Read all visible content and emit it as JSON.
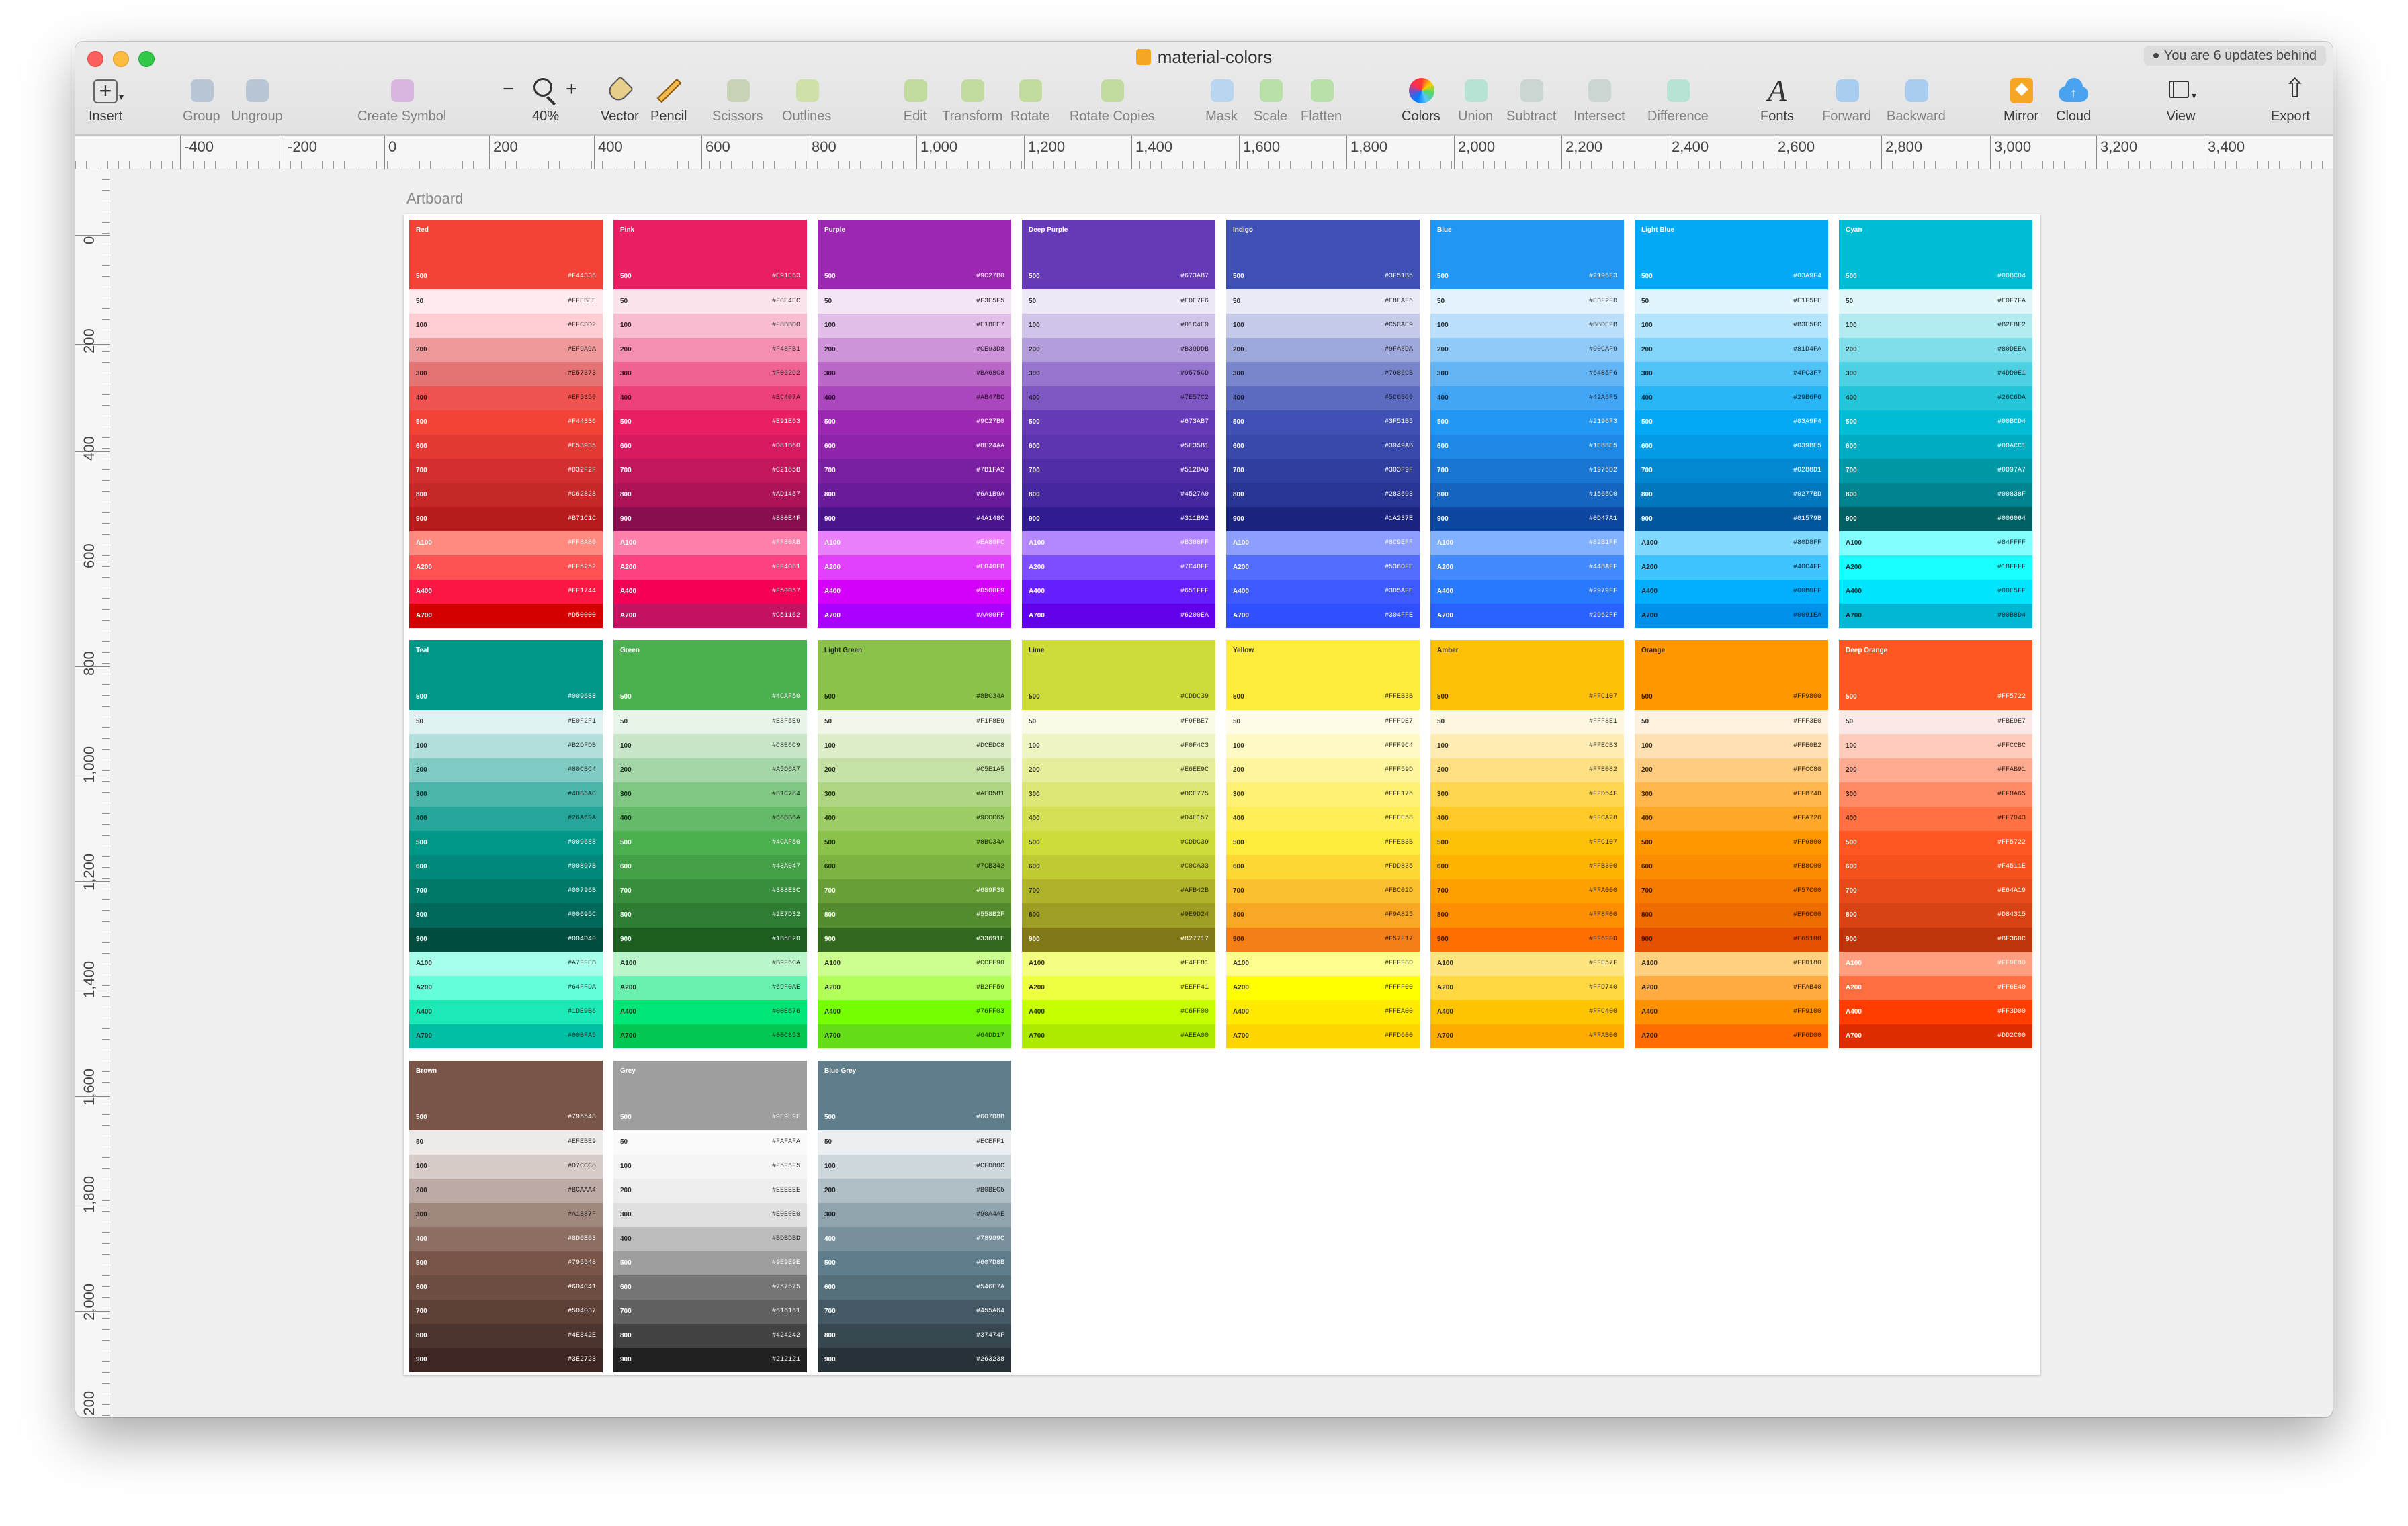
{
  "window": {
    "title": "material-colors",
    "updates_badge": "You are 6 updates behind"
  },
  "toolbar": {
    "items": [
      {
        "label": "Insert",
        "icon": "plus-icon"
      },
      {
        "label": "Group",
        "icon": "group-icon"
      },
      {
        "label": "Ungroup",
        "icon": "ungroup-icon"
      },
      {
        "label": "Create Symbol",
        "icon": "symbol-icon"
      },
      {
        "label": "40%",
        "icon": "zoom-icon"
      },
      {
        "label": "Vector",
        "icon": "vector-pen-icon"
      },
      {
        "label": "Pencil",
        "icon": "pencil-icon"
      },
      {
        "label": "Scissors",
        "icon": "scissors-icon"
      },
      {
        "label": "Outlines",
        "icon": "outlines-icon"
      },
      {
        "label": "Edit",
        "icon": "edit-icon"
      },
      {
        "label": "Transform",
        "icon": "transform-icon"
      },
      {
        "label": "Rotate",
        "icon": "rotate-icon"
      },
      {
        "label": "Rotate Copies",
        "icon": "rotate-copies-icon"
      },
      {
        "label": "Mask",
        "icon": "mask-icon"
      },
      {
        "label": "Scale",
        "icon": "scale-icon"
      },
      {
        "label": "Flatten",
        "icon": "flatten-icon"
      },
      {
        "label": "Colors",
        "icon": "color-wheel-icon"
      },
      {
        "label": "Union",
        "icon": "union-icon"
      },
      {
        "label": "Subtract",
        "icon": "subtract-icon"
      },
      {
        "label": "Intersect",
        "icon": "intersect-icon"
      },
      {
        "label": "Difference",
        "icon": "difference-icon"
      },
      {
        "label": "Fonts",
        "icon": "font-icon"
      },
      {
        "label": "Forward",
        "icon": "forward-icon"
      },
      {
        "label": "Backward",
        "icon": "backward-icon"
      },
      {
        "label": "Mirror",
        "icon": "mirror-icon"
      },
      {
        "label": "Cloud",
        "icon": "cloud-icon"
      },
      {
        "label": "View",
        "icon": "view-icon"
      },
      {
        "label": "Export",
        "icon": "export-icon"
      }
    ],
    "zoom_minus": "−",
    "zoom_plus": "+"
  },
  "ruler": {
    "horizontal": [
      "-400",
      "-200",
      "0",
      "200",
      "400",
      "600",
      "800",
      "1,000",
      "1,200",
      "1,400",
      "1,600",
      "1,800",
      "2,000",
      "2,200",
      "2,400",
      "2,600",
      "2,800",
      "3,000",
      "3,200",
      "3,400"
    ],
    "vertical": [
      "0",
      "200",
      "400",
      "600",
      "800",
      "1,000",
      "1,200",
      "1,400",
      "1,600",
      "1,800",
      "2,000",
      "2,200"
    ]
  },
  "artboard": {
    "label": "Artboard"
  },
  "palettes": [
    {
      "name": "Red",
      "head_hex": "#F44336",
      "text": "light",
      "rows": [
        [
          "50",
          "#FFEBEE"
        ],
        [
          "100",
          "#FFCDD2"
        ],
        [
          "200",
          "#EF9A9A"
        ],
        [
          "300",
          "#E57373"
        ],
        [
          "400",
          "#EF5350"
        ],
        [
          "500",
          "#F44336"
        ],
        [
          "600",
          "#E53935"
        ],
        [
          "700",
          "#D32F2F"
        ],
        [
          "800",
          "#C62828"
        ],
        [
          "900",
          "#B71C1C"
        ],
        [
          "A100",
          "#FF8A80"
        ],
        [
          "A200",
          "#FF5252"
        ],
        [
          "A400",
          "#FF1744"
        ],
        [
          "A700",
          "#D50000"
        ]
      ]
    },
    {
      "name": "Pink",
      "head_hex": "#E91E63",
      "text": "light",
      "rows": [
        [
          "50",
          "#FCE4EC"
        ],
        [
          "100",
          "#F8BBD0"
        ],
        [
          "200",
          "#F48FB1"
        ],
        [
          "300",
          "#F06292"
        ],
        [
          "400",
          "#EC407A"
        ],
        [
          "500",
          "#E91E63"
        ],
        [
          "600",
          "#D81B60"
        ],
        [
          "700",
          "#C2185B"
        ],
        [
          "800",
          "#AD1457"
        ],
        [
          "900",
          "#880E4F"
        ],
        [
          "A100",
          "#FF80AB"
        ],
        [
          "A200",
          "#FF4081"
        ],
        [
          "A400",
          "#F50057"
        ],
        [
          "A700",
          "#C51162"
        ]
      ]
    },
    {
      "name": "Purple",
      "head_hex": "#9C27B0",
      "text": "light",
      "rows": [
        [
          "50",
          "#F3E5F5"
        ],
        [
          "100",
          "#E1BEE7"
        ],
        [
          "200",
          "#CE93D8"
        ],
        [
          "300",
          "#BA68C8"
        ],
        [
          "400",
          "#AB47BC"
        ],
        [
          "500",
          "#9C27B0"
        ],
        [
          "600",
          "#8E24AA"
        ],
        [
          "700",
          "#7B1FA2"
        ],
        [
          "800",
          "#6A1B9A"
        ],
        [
          "900",
          "#4A148C"
        ],
        [
          "A100",
          "#EA80FC"
        ],
        [
          "A200",
          "#E040FB"
        ],
        [
          "A400",
          "#D500F9"
        ],
        [
          "A700",
          "#AA00FF"
        ]
      ]
    },
    {
      "name": "Deep Purple",
      "head_hex": "#673AB7",
      "text": "light",
      "rows": [
        [
          "50",
          "#EDE7F6"
        ],
        [
          "100",
          "#D1C4E9"
        ],
        [
          "200",
          "#B39DDB"
        ],
        [
          "300",
          "#9575CD"
        ],
        [
          "400",
          "#7E57C2"
        ],
        [
          "500",
          "#673AB7"
        ],
        [
          "600",
          "#5E35B1"
        ],
        [
          "700",
          "#512DA8"
        ],
        [
          "800",
          "#4527A0"
        ],
        [
          "900",
          "#311B92"
        ],
        [
          "A100",
          "#B388FF"
        ],
        [
          "A200",
          "#7C4DFF"
        ],
        [
          "A400",
          "#651FFF"
        ],
        [
          "A700",
          "#6200EA"
        ]
      ]
    },
    {
      "name": "Indigo",
      "head_hex": "#3F51B5",
      "text": "light",
      "rows": [
        [
          "50",
          "#E8EAF6"
        ],
        [
          "100",
          "#C5CAE9"
        ],
        [
          "200",
          "#9FA8DA"
        ],
        [
          "300",
          "#7986CB"
        ],
        [
          "400",
          "#5C6BC0"
        ],
        [
          "500",
          "#3F51B5"
        ],
        [
          "600",
          "#3949AB"
        ],
        [
          "700",
          "#303F9F"
        ],
        [
          "800",
          "#283593"
        ],
        [
          "900",
          "#1A237E"
        ],
        [
          "A100",
          "#8C9EFF"
        ],
        [
          "A200",
          "#536DFE"
        ],
        [
          "A400",
          "#3D5AFE"
        ],
        [
          "A700",
          "#304FFE"
        ]
      ]
    },
    {
      "name": "Blue",
      "head_hex": "#2196F3",
      "text": "light",
      "rows": [
        [
          "50",
          "#E3F2FD"
        ],
        [
          "100",
          "#BBDEFB"
        ],
        [
          "200",
          "#90CAF9"
        ],
        [
          "300",
          "#64B5F6"
        ],
        [
          "400",
          "#42A5F5"
        ],
        [
          "500",
          "#2196F3"
        ],
        [
          "600",
          "#1E88E5"
        ],
        [
          "700",
          "#1976D2"
        ],
        [
          "800",
          "#1565C0"
        ],
        [
          "900",
          "#0D47A1"
        ],
        [
          "A100",
          "#82B1FF"
        ],
        [
          "A200",
          "#448AFF"
        ],
        [
          "A400",
          "#2979FF"
        ],
        [
          "A700",
          "#2962FF"
        ]
      ]
    },
    {
      "name": "Light Blue",
      "head_hex": "#03A9F4",
      "text": "light",
      "rows": [
        [
          "50",
          "#E1F5FE"
        ],
        [
          "100",
          "#B3E5FC"
        ],
        [
          "200",
          "#81D4FA"
        ],
        [
          "300",
          "#4FC3F7"
        ],
        [
          "400",
          "#29B6F6"
        ],
        [
          "500",
          "#03A9F4"
        ],
        [
          "600",
          "#039BE5"
        ],
        [
          "700",
          "#0288D1"
        ],
        [
          "800",
          "#0277BD"
        ],
        [
          "900",
          "#01579B"
        ],
        [
          "A100",
          "#80D8FF"
        ],
        [
          "A200",
          "#40C4FF"
        ],
        [
          "A400",
          "#00B0FF"
        ],
        [
          "A700",
          "#0091EA"
        ]
      ]
    },
    {
      "name": "Cyan",
      "head_hex": "#00BCD4",
      "text": "light",
      "rows": [
        [
          "50",
          "#E0F7FA"
        ],
        [
          "100",
          "#B2EBF2"
        ],
        [
          "200",
          "#80DEEA"
        ],
        [
          "300",
          "#4DD0E1"
        ],
        [
          "400",
          "#26C6DA"
        ],
        [
          "500",
          "#00BCD4"
        ],
        [
          "600",
          "#00ACC1"
        ],
        [
          "700",
          "#0097A7"
        ],
        [
          "800",
          "#00838F"
        ],
        [
          "900",
          "#006064"
        ],
        [
          "A100",
          "#84FFFF"
        ],
        [
          "A200",
          "#18FFFF"
        ],
        [
          "A400",
          "#00E5FF"
        ],
        [
          "A700",
          "#00B8D4"
        ]
      ]
    },
    {
      "name": "Teal",
      "head_hex": "#009688",
      "text": "light",
      "rows": [
        [
          "50",
          "#E0F2F1"
        ],
        [
          "100",
          "#B2DFDB"
        ],
        [
          "200",
          "#80CBC4"
        ],
        [
          "300",
          "#4DB6AC"
        ],
        [
          "400",
          "#26A69A"
        ],
        [
          "500",
          "#009688"
        ],
        [
          "600",
          "#00897B"
        ],
        [
          "700",
          "#00796B"
        ],
        [
          "800",
          "#00695C"
        ],
        [
          "900",
          "#004D40"
        ],
        [
          "A100",
          "#A7FFEB"
        ],
        [
          "A200",
          "#64FFDA"
        ],
        [
          "A400",
          "#1DE9B6"
        ],
        [
          "A700",
          "#00BFA5"
        ]
      ]
    },
    {
      "name": "Green",
      "head_hex": "#4CAF50",
      "text": "light",
      "rows": [
        [
          "50",
          "#E8F5E9"
        ],
        [
          "100",
          "#C8E6C9"
        ],
        [
          "200",
          "#A5D6A7"
        ],
        [
          "300",
          "#81C784"
        ],
        [
          "400",
          "#66BB6A"
        ],
        [
          "500",
          "#4CAF50"
        ],
        [
          "600",
          "#43A047"
        ],
        [
          "700",
          "#388E3C"
        ],
        [
          "800",
          "#2E7D32"
        ],
        [
          "900",
          "#1B5E20"
        ],
        [
          "A100",
          "#B9F6CA"
        ],
        [
          "A200",
          "#69F0AE"
        ],
        [
          "A400",
          "#00E676"
        ],
        [
          "A700",
          "#00C853"
        ]
      ]
    },
    {
      "name": "Light Green",
      "head_hex": "#8BC34A",
      "text": "dark",
      "rows": [
        [
          "50",
          "#F1F8E9"
        ],
        [
          "100",
          "#DCEDC8"
        ],
        [
          "200",
          "#C5E1A5"
        ],
        [
          "300",
          "#AED581"
        ],
        [
          "400",
          "#9CCC65"
        ],
        [
          "500",
          "#8BC34A"
        ],
        [
          "600",
          "#7CB342"
        ],
        [
          "700",
          "#689F38"
        ],
        [
          "800",
          "#558B2F"
        ],
        [
          "900",
          "#33691E"
        ],
        [
          "A100",
          "#CCFF90"
        ],
        [
          "A200",
          "#B2FF59"
        ],
        [
          "A400",
          "#76FF03"
        ],
        [
          "A700",
          "#64DD17"
        ]
      ]
    },
    {
      "name": "Lime",
      "head_hex": "#CDDC39",
      "text": "dark",
      "rows": [
        [
          "50",
          "#F9FBE7"
        ],
        [
          "100",
          "#F0F4C3"
        ],
        [
          "200",
          "#E6EE9C"
        ],
        [
          "300",
          "#DCE775"
        ],
        [
          "400",
          "#D4E157"
        ],
        [
          "500",
          "#CDDC39"
        ],
        [
          "600",
          "#C0CA33"
        ],
        [
          "700",
          "#AFB42B"
        ],
        [
          "800",
          "#9E9D24"
        ],
        [
          "900",
          "#827717"
        ],
        [
          "A100",
          "#F4FF81"
        ],
        [
          "A200",
          "#EEFF41"
        ],
        [
          "A400",
          "#C6FF00"
        ],
        [
          "A700",
          "#AEEA00"
        ]
      ]
    },
    {
      "name": "Yellow",
      "head_hex": "#FFEB3B",
      "text": "dark",
      "rows": [
        [
          "50",
          "#FFFDE7"
        ],
        [
          "100",
          "#FFF9C4"
        ],
        [
          "200",
          "#FFF59D"
        ],
        [
          "300",
          "#FFF176"
        ],
        [
          "400",
          "#FFEE58"
        ],
        [
          "500",
          "#FFEB3B"
        ],
        [
          "600",
          "#FDD835"
        ],
        [
          "700",
          "#FBC02D"
        ],
        [
          "800",
          "#F9A825"
        ],
        [
          "900",
          "#F57F17"
        ],
        [
          "A100",
          "#FFFF8D"
        ],
        [
          "A200",
          "#FFFF00"
        ],
        [
          "A400",
          "#FFEA00"
        ],
        [
          "A700",
          "#FFD600"
        ]
      ]
    },
    {
      "name": "Amber",
      "head_hex": "#FFC107",
      "text": "dark",
      "rows": [
        [
          "50",
          "#FFF8E1"
        ],
        [
          "100",
          "#FFECB3"
        ],
        [
          "200",
          "#FFE082"
        ],
        [
          "300",
          "#FFD54F"
        ],
        [
          "400",
          "#FFCA28"
        ],
        [
          "500",
          "#FFC107"
        ],
        [
          "600",
          "#FFB300"
        ],
        [
          "700",
          "#FFA000"
        ],
        [
          "800",
          "#FF8F00"
        ],
        [
          "900",
          "#FF6F00"
        ],
        [
          "A100",
          "#FFE57F"
        ],
        [
          "A200",
          "#FFD740"
        ],
        [
          "A400",
          "#FFC400"
        ],
        [
          "A700",
          "#FFAB00"
        ]
      ]
    },
    {
      "name": "Orange",
      "head_hex": "#FF9800",
      "text": "dark",
      "rows": [
        [
          "50",
          "#FFF3E0"
        ],
        [
          "100",
          "#FFE0B2"
        ],
        [
          "200",
          "#FFCC80"
        ],
        [
          "300",
          "#FFB74D"
        ],
        [
          "400",
          "#FFA726"
        ],
        [
          "500",
          "#FF9800"
        ],
        [
          "600",
          "#FB8C00"
        ],
        [
          "700",
          "#F57C00"
        ],
        [
          "800",
          "#EF6C00"
        ],
        [
          "900",
          "#E65100"
        ],
        [
          "A100",
          "#FFD180"
        ],
        [
          "A200",
          "#FFAB40"
        ],
        [
          "A400",
          "#FF9100"
        ],
        [
          "A700",
          "#FF6D00"
        ]
      ]
    },
    {
      "name": "Deep Orange",
      "head_hex": "#FF5722",
      "text": "light",
      "rows": [
        [
          "50",
          "#FBE9E7"
        ],
        [
          "100",
          "#FFCCBC"
        ],
        [
          "200",
          "#FFAB91"
        ],
        [
          "300",
          "#FF8A65"
        ],
        [
          "400",
          "#FF7043"
        ],
        [
          "500",
          "#FF5722"
        ],
        [
          "600",
          "#F4511E"
        ],
        [
          "700",
          "#E64A19"
        ],
        [
          "800",
          "#D84315"
        ],
        [
          "900",
          "#BF360C"
        ],
        [
          "A100",
          "#FF9E80"
        ],
        [
          "A200",
          "#FF6E40"
        ],
        [
          "A400",
          "#FF3D00"
        ],
        [
          "A700",
          "#DD2C00"
        ]
      ]
    },
    {
      "name": "Brown",
      "head_hex": "#795548",
      "text": "light",
      "rows": [
        [
          "50",
          "#EFEBE9"
        ],
        [
          "100",
          "#D7CCC8"
        ],
        [
          "200",
          "#BCAAA4"
        ],
        [
          "300",
          "#A1887F"
        ],
        [
          "400",
          "#8D6E63"
        ],
        [
          "500",
          "#795548"
        ],
        [
          "600",
          "#6D4C41"
        ],
        [
          "700",
          "#5D4037"
        ],
        [
          "800",
          "#4E342E"
        ],
        [
          "900",
          "#3E2723"
        ]
      ]
    },
    {
      "name": "Grey",
      "head_hex": "#9E9E9E",
      "text": "light",
      "rows": [
        [
          "50",
          "#FAFAFA"
        ],
        [
          "100",
          "#F5F5F5"
        ],
        [
          "200",
          "#EEEEEE"
        ],
        [
          "300",
          "#E0E0E0"
        ],
        [
          "400",
          "#BDBDBD"
        ],
        [
          "500",
          "#9E9E9E"
        ],
        [
          "600",
          "#757575"
        ],
        [
          "700",
          "#616161"
        ],
        [
          "800",
          "#424242"
        ],
        [
          "900",
          "#212121"
        ]
      ]
    },
    {
      "name": "Blue Grey",
      "head_hex": "#607D8B",
      "text": "light",
      "rows": [
        [
          "50",
          "#ECEFF1"
        ],
        [
          "100",
          "#CFD8DC"
        ],
        [
          "200",
          "#B0BEC5"
        ],
        [
          "300",
          "#90A4AE"
        ],
        [
          "400",
          "#78909C"
        ],
        [
          "500",
          "#607D8B"
        ],
        [
          "600",
          "#546E7A"
        ],
        [
          "700",
          "#455A64"
        ],
        [
          "800",
          "#37474F"
        ],
        [
          "900",
          "#263238"
        ]
      ]
    }
  ]
}
